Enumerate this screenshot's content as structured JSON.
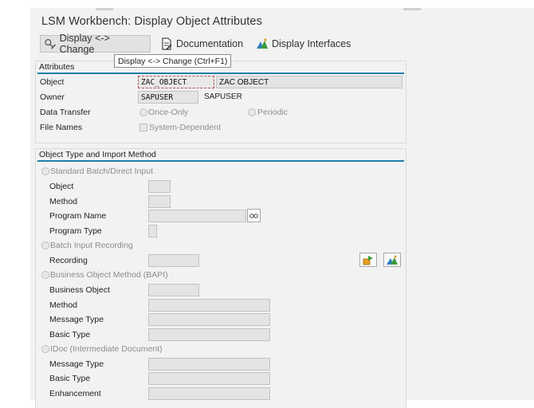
{
  "window": {
    "title": "LSM Workbench: Display Object Attributes"
  },
  "toolbar": {
    "display_change": "Display <-> Change",
    "documentation": "Documentation",
    "display_interfaces": "Display Interfaces",
    "tooltip": "Display <-> Change   (Ctrl+F1)"
  },
  "attributes": {
    "title": "Attributes",
    "object_label": "Object",
    "object_value": "ZAC_OBJECT",
    "object_desc": "ZAC OBJECT",
    "owner_label": "Owner",
    "owner_value": "SAPUSER",
    "owner_desc": "SAPUSER",
    "data_transfer_label": "Data Transfer",
    "once_only": "Once-Only",
    "periodic": "Periodic",
    "file_names_label": "File Names",
    "system_dependent": "System-Dependent"
  },
  "import_method": {
    "title": "Object Type and Import Method",
    "standard_batch": "Standard Batch/Direct Input",
    "sb_object": "Object",
    "sb_method": "Method",
    "sb_program_name": "Program Name",
    "sb_program_type": "Program Type",
    "batch_input": "Batch Input Recording",
    "recording": "Recording",
    "bapi": "Business Object Method  (BAPI)",
    "bo_business_object": "Business Object",
    "bo_method": "Method",
    "bo_message_type": "Message Type",
    "bo_basic_type": "Basic Type",
    "idoc": "IDoc (Intermediate Document)",
    "id_message_type": "Message Type",
    "id_basic_type": "Basic Type",
    "id_enhancement": "Enhancement"
  },
  "colors": {
    "accent_line": "#1c7fa8",
    "background": "#f2f2f2"
  },
  "icons": [
    "display-change-icon",
    "documentation-icon",
    "display-interfaces-icon",
    "search-help-icon",
    "create-recording-icon",
    "display-structure-icon"
  ]
}
